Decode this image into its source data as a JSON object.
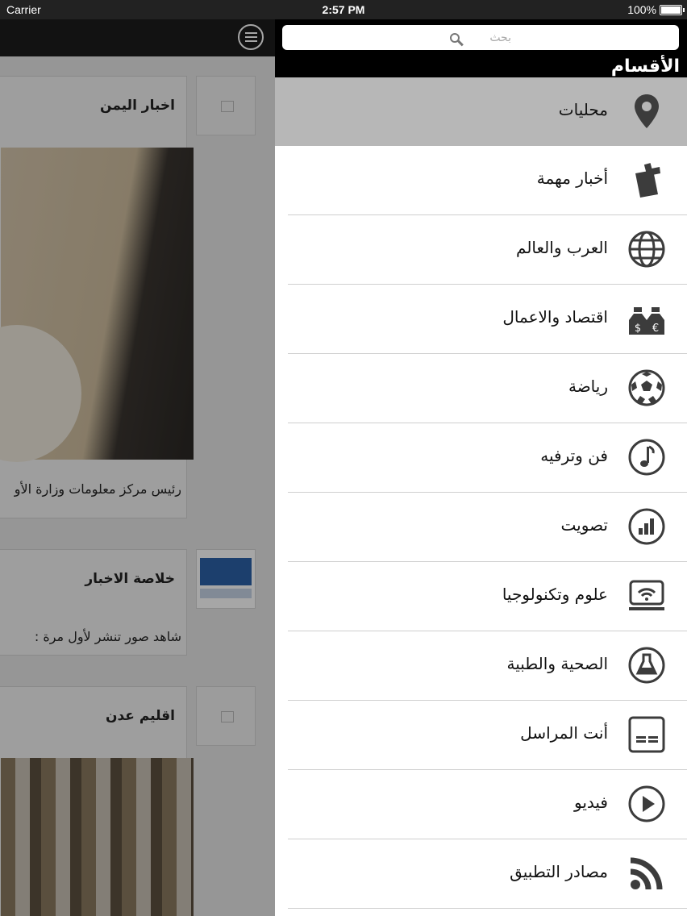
{
  "status_bar": {
    "carrier": "Carrier",
    "time": "2:57 PM",
    "battery": "100%"
  },
  "feed": {
    "cards": [
      {
        "title": "اخبار اليمن",
        "text": "رئيس مركز معلومات وزارة الأو"
      },
      {
        "title": "خلاصة الاخبار",
        "text": "شاهد صور تنشر لأول مرة :"
      },
      {
        "title": "اقليم عدن",
        "text": ""
      }
    ]
  },
  "panel": {
    "search_placeholder": "بحث",
    "title": "الأقسام",
    "items": [
      {
        "label": "محليات",
        "icon": "location-pin-icon",
        "active": true
      },
      {
        "label": "أخبار مهمة",
        "icon": "important-news-icon"
      },
      {
        "label": "العرب والعالم",
        "icon": "globe-icon"
      },
      {
        "label": "اقتصاد والاعمال",
        "icon": "money-bags-icon"
      },
      {
        "label": "رياضة",
        "icon": "soccer-ball-icon"
      },
      {
        "label": "فن وترفيه",
        "icon": "music-note-icon"
      },
      {
        "label": "تصويت",
        "icon": "poll-chart-icon"
      },
      {
        "label": "علوم وتكنولوجيا",
        "icon": "laptop-wifi-icon"
      },
      {
        "label": "الصحية والطبية",
        "icon": "flask-icon"
      },
      {
        "label": "أنت المراسل",
        "icon": "reporter-card-icon"
      },
      {
        "label": "فيديو",
        "icon": "play-icon"
      },
      {
        "label": "مصادر التطبيق",
        "icon": "rss-icon"
      }
    ]
  },
  "colors": {
    "menu_bg": "#ffffff",
    "active_item": "#b7b7b7",
    "icon": "#3c3c3c",
    "top_bar": "#000000"
  }
}
